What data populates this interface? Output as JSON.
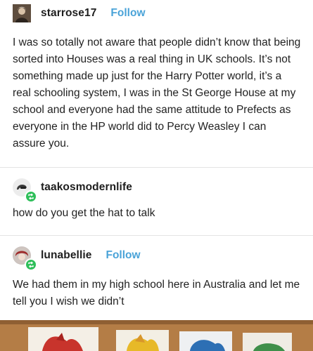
{
  "posts": [
    {
      "username": "starrose17",
      "follow_label": "Follow",
      "text": "I was so totally not aware that people didn’t know that being sorted into Houses was a real thing in UK schools. It’s not something made up just for the Harry Potter world, it’s a real schooling system, I was in the St George House at my school and everyone had the same attitude to Prefects as everyone in the HP world did to Percy Weasley I can assure you."
    },
    {
      "username": "taakosmodernlife",
      "text": "how do you get the hat to talk"
    },
    {
      "username": "lunabellie",
      "follow_label": "Follow",
      "text": "We had them in my high school here in Australia and let me tell you I wish we didn’t"
    }
  ],
  "icons": {
    "reblog": "reblog-icon",
    "avatar": "avatar-icon"
  },
  "colors": {
    "follow": "#4aa3d8",
    "reblog_badge": "#2fbf5a",
    "photo_background": "#b47d46"
  }
}
